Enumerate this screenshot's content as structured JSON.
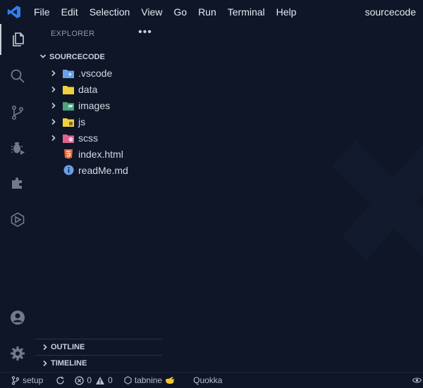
{
  "menu": {
    "items": [
      "File",
      "Edit",
      "Selection",
      "View",
      "Go",
      "Run",
      "Terminal",
      "Help"
    ]
  },
  "window_title": "sourcecode",
  "activity_bar": [
    "explorer-icon",
    "search-icon",
    "source-control-icon",
    "run-debug-icon",
    "extensions-icon",
    "quokka-icon",
    "account-icon",
    "gear-icon"
  ],
  "explorer": {
    "header": "EXPLORER",
    "more": "•••",
    "folder": "SOURCECODE",
    "items": [
      {
        "label": ".vscode",
        "type": "folder",
        "icon": "vscode-folder-icon",
        "color": "#6aa0e8"
      },
      {
        "label": "data",
        "type": "folder",
        "icon": "folder-icon",
        "color": "#f2cf3e"
      },
      {
        "label": "images",
        "type": "folder",
        "icon": "images-folder-icon",
        "color": "#4aa37a"
      },
      {
        "label": "js",
        "type": "folder",
        "icon": "js-folder-icon",
        "color": "#f2cf3e"
      },
      {
        "label": "scss",
        "type": "folder",
        "icon": "scss-folder-icon",
        "color": "#e0628e"
      },
      {
        "label": "index.html",
        "type": "file",
        "icon": "html-file-icon",
        "color": "#e8673c"
      },
      {
        "label": "readMe.md",
        "type": "file",
        "icon": "info-file-icon",
        "color": "#6aa0e8"
      }
    ]
  },
  "sections": {
    "outline": "OUTLINE",
    "timeline": "TIMELINE"
  },
  "status": {
    "branch": "setup",
    "errors": "0",
    "warnings": "0",
    "tabnine": "tabnine",
    "quokka": "Quokka"
  },
  "colors": {
    "background": "#0e1628",
    "foreground": "#c9d1dc",
    "accent": "#2f80ed"
  }
}
